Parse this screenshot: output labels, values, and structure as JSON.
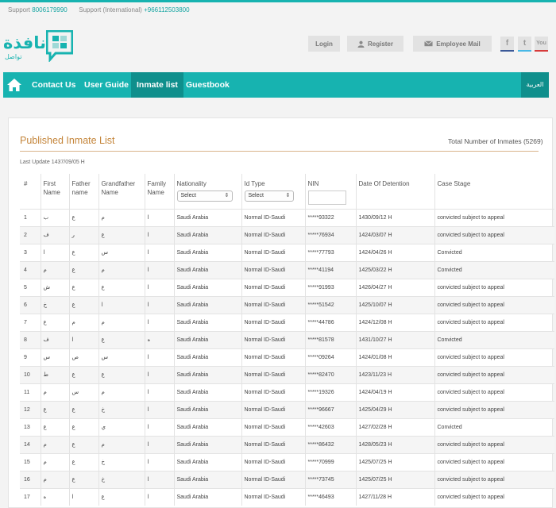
{
  "header": {
    "support_label": "Support",
    "support_phone": "8006179990",
    "support_intl_label": "Support (International)",
    "support_intl_phone": "+966112503800",
    "logo_text": "نافذة",
    "logo_subtext": "تواصل",
    "buttons": {
      "login": "Login",
      "register": "Register",
      "employee_mail": "Employee Mail"
    },
    "social": {
      "facebook": "f",
      "twitter": "t",
      "youtube": "You"
    }
  },
  "nav": {
    "items": [
      {
        "label": "Contact Us"
      },
      {
        "label": "User Guide"
      },
      {
        "label": "Inmate list"
      },
      {
        "label": "Guestbook"
      }
    ],
    "active_index": 2,
    "language": "العربية"
  },
  "main": {
    "title": "Published Inmate List",
    "total": "Total Number of Inmates (5269)",
    "last_update": "Last Update 1437/09/05 H"
  },
  "table": {
    "headers": {
      "index": "#",
      "first_name": "First Name",
      "father_name": "Father name",
      "grandfather_name": "Grandfather Name",
      "family_name": "Family Name",
      "nationality": "Nationality",
      "id_type": "Id Type",
      "nin": "NIN",
      "detention": "Date Of Detention",
      "case_stage": "Case Stage"
    },
    "nationality_select": "Select",
    "id_type_select": "Select",
    "rows": [
      {
        "n": "1",
        "first": "ب",
        "father": "ع",
        "grand": "م",
        "family": "ا",
        "nat": "Saudi Arabia",
        "idtype": "Normal ID-Saudi",
        "nin": "*****93322",
        "date": "1430/09/12 H",
        "stage": "convicted subject to appeal"
      },
      {
        "n": "2",
        "first": "ف",
        "father": "ر",
        "grand": "ع",
        "family": "ا",
        "nat": "Saudi Arabia",
        "idtype": "Normal ID-Saudi",
        "nin": "*****76934",
        "date": "1424/03/07 H",
        "stage": "convicted subject to appeal"
      },
      {
        "n": "3",
        "first": "ا",
        "father": "ع",
        "grand": "س",
        "family": "ا",
        "nat": "Saudi Arabia",
        "idtype": "Normal ID-Saudi",
        "nin": "*****77793",
        "date": "1424/04/26 H",
        "stage": "Convicted"
      },
      {
        "n": "4",
        "first": "م",
        "father": "ع",
        "grand": "م",
        "family": "ا",
        "nat": "Saudi Arabia",
        "idtype": "Normal ID-Saudi",
        "nin": "*****41194",
        "date": "1425/03/22 H",
        "stage": "Convicted"
      },
      {
        "n": "5",
        "first": "ش",
        "father": "ع",
        "grand": "ع",
        "family": "ا",
        "nat": "Saudi Arabia",
        "idtype": "Normal ID-Saudi",
        "nin": "*****91993",
        "date": "1426/04/27 H",
        "stage": "convicted subject to appeal"
      },
      {
        "n": "6",
        "first": "خ",
        "father": "ع",
        "grand": "ا",
        "family": "ا",
        "nat": "Saudi Arabia",
        "idtype": "Normal ID-Saudi",
        "nin": "*****51542",
        "date": "1425/10/07 H",
        "stage": "convicted subject to appeal"
      },
      {
        "n": "7",
        "first": "ع",
        "father": "م",
        "grand": "م",
        "family": "ا",
        "nat": "Saudi Arabia",
        "idtype": "Normal ID-Saudi",
        "nin": "*****44786",
        "date": "1424/12/08 H",
        "stage": "convicted subject to appeal"
      },
      {
        "n": "8",
        "first": "ف",
        "father": "ا",
        "grand": "ع",
        "family": "ه",
        "nat": "Saudi Arabia",
        "idtype": "Normal ID-Saudi",
        "nin": "*****81578",
        "date": "1431/10/27 H",
        "stage": "Convicted"
      },
      {
        "n": "9",
        "first": "س",
        "father": "ص",
        "grand": "س",
        "family": "ا",
        "nat": "Saudi Arabia",
        "idtype": "Normal ID-Saudi",
        "nin": "*****09264",
        "date": "1424/01/08 H",
        "stage": "convicted subject to appeal"
      },
      {
        "n": "10",
        "first": "ط",
        "father": "ع",
        "grand": "ع",
        "family": "ا",
        "nat": "Saudi Arabia",
        "idtype": "Normal ID-Saudi",
        "nin": "*****82470",
        "date": "1423/11/23 H",
        "stage": "convicted subject to appeal"
      },
      {
        "n": "11",
        "first": "م",
        "father": "س",
        "grand": "م",
        "family": "ا",
        "nat": "Saudi Arabia",
        "idtype": "Normal ID-Saudi",
        "nin": "*****19326",
        "date": "1424/04/19 H",
        "stage": "convicted subject to appeal"
      },
      {
        "n": "12",
        "first": "ع",
        "father": "ع",
        "grand": "خ",
        "family": "ا",
        "nat": "Saudi Arabia",
        "idtype": "Normal ID-Saudi",
        "nin": "*****96667",
        "date": "1425/04/29 H",
        "stage": "convicted subject to appeal"
      },
      {
        "n": "13",
        "first": "ع",
        "father": "ع",
        "grand": "ي",
        "family": "ا",
        "nat": "Saudi Arabia",
        "idtype": "Normal ID-Saudi",
        "nin": "*****42603",
        "date": "1427/02/28 H",
        "stage": "Convicted"
      },
      {
        "n": "14",
        "first": "م",
        "father": "ع",
        "grand": "م",
        "family": "ا",
        "nat": "Saudi Arabia",
        "idtype": "Normal ID-Saudi",
        "nin": "*****86432",
        "date": "1428/05/23 H",
        "stage": "convicted subject to appeal"
      },
      {
        "n": "15",
        "first": "م",
        "father": "ع",
        "grand": "خ",
        "family": "ا",
        "nat": "Saudi Arabia",
        "idtype": "Normal ID-Saudi",
        "nin": "*****70999",
        "date": "1425/07/25 H",
        "stage": "convicted subject to appeal"
      },
      {
        "n": "16",
        "first": "م",
        "father": "ع",
        "grand": "خ",
        "family": "ا",
        "nat": "Saudi Arabia",
        "idtype": "Normal ID-Saudi",
        "nin": "*****73745",
        "date": "1425/07/25 H",
        "stage": "convicted subject to appeal"
      },
      {
        "n": "17",
        "first": "ه",
        "father": "ا",
        "grand": "ع",
        "family": "ا",
        "nat": "Saudi Arabia",
        "idtype": "Normal ID-Saudi",
        "nin": "*****46493",
        "date": "1427/11/28 H",
        "stage": "convicted subject to appeal"
      }
    ]
  },
  "colors": {
    "brand": "#17b3b0",
    "brand_dark": "#0f8f8c",
    "title": "#c4853a"
  }
}
